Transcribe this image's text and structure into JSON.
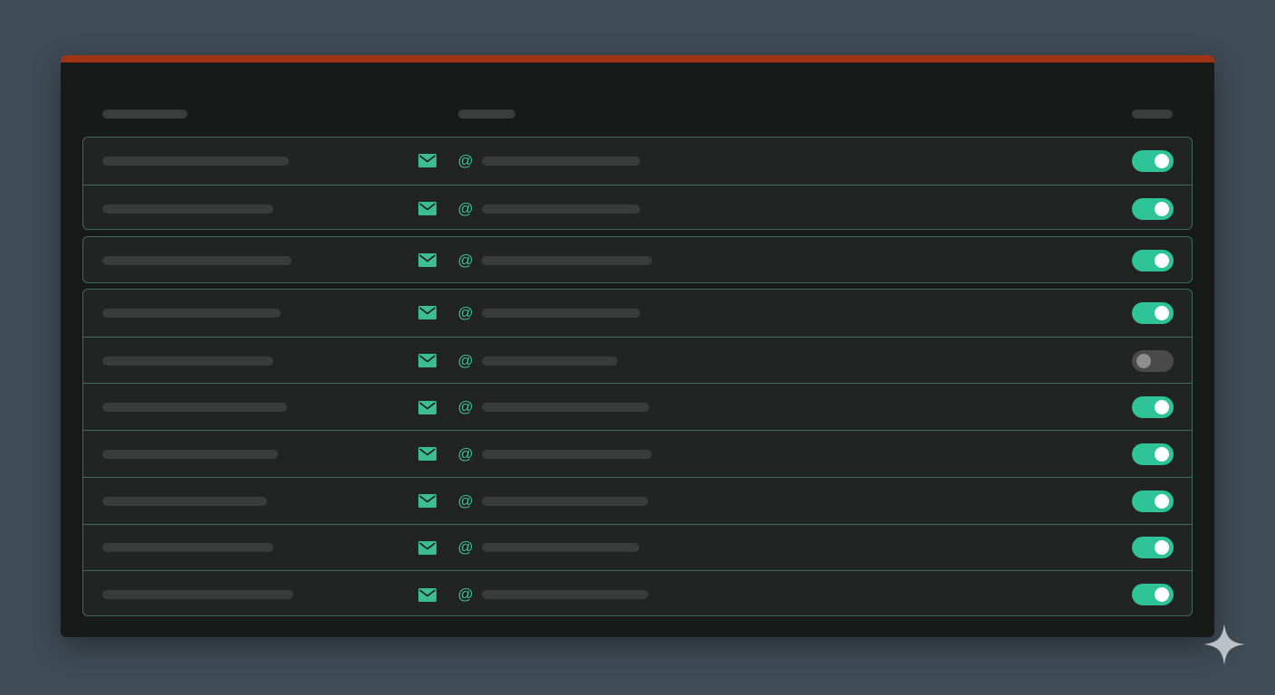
{
  "colors": {
    "background": "#3f4b55",
    "panel": "#181919",
    "accent_top_bar": "#a13414",
    "row_border": "#3d6a5c",
    "icon_green": "#3dbd92",
    "toggle_on": "#2ec497",
    "toggle_off": "#4a4a4a"
  },
  "header": {
    "columns": [
      {
        "name": "name-column-header",
        "label": ""
      },
      {
        "name": "email-column-header",
        "label": ""
      },
      {
        "name": "status-column-header",
        "label": ""
      }
    ]
  },
  "rows": [
    {
      "group": 1,
      "name": "",
      "email": "",
      "mail_icon": "envelope-icon",
      "at_icon": "at-icon",
      "enabled": true
    },
    {
      "group": 1,
      "name": "",
      "email": "",
      "mail_icon": "envelope-icon",
      "at_icon": "at-icon",
      "enabled": true
    },
    {
      "group": 2,
      "name": "",
      "email": "",
      "mail_icon": "envelope-icon",
      "at_icon": "at-icon",
      "enabled": true
    },
    {
      "group": 3,
      "name": "",
      "email": "",
      "mail_icon": "envelope-icon",
      "at_icon": "at-icon",
      "enabled": true
    },
    {
      "group": 3,
      "name": "",
      "email": "",
      "mail_icon": "envelope-icon",
      "at_icon": "at-icon",
      "enabled": false
    },
    {
      "group": 3,
      "name": "",
      "email": "",
      "mail_icon": "envelope-icon",
      "at_icon": "at-icon",
      "enabled": true
    },
    {
      "group": 3,
      "name": "",
      "email": "",
      "mail_icon": "envelope-icon",
      "at_icon": "at-icon",
      "enabled": true
    },
    {
      "group": 3,
      "name": "",
      "email": "",
      "mail_icon": "envelope-icon",
      "at_icon": "at-icon",
      "enabled": true
    },
    {
      "group": 3,
      "name": "",
      "email": "",
      "mail_icon": "envelope-icon",
      "at_icon": "at-icon",
      "enabled": true
    },
    {
      "group": 3,
      "name": "",
      "email": "",
      "mail_icon": "envelope-icon",
      "at_icon": "at-icon",
      "enabled": true
    }
  ],
  "decoration": {
    "corner_icon": "sparkle-icon"
  }
}
